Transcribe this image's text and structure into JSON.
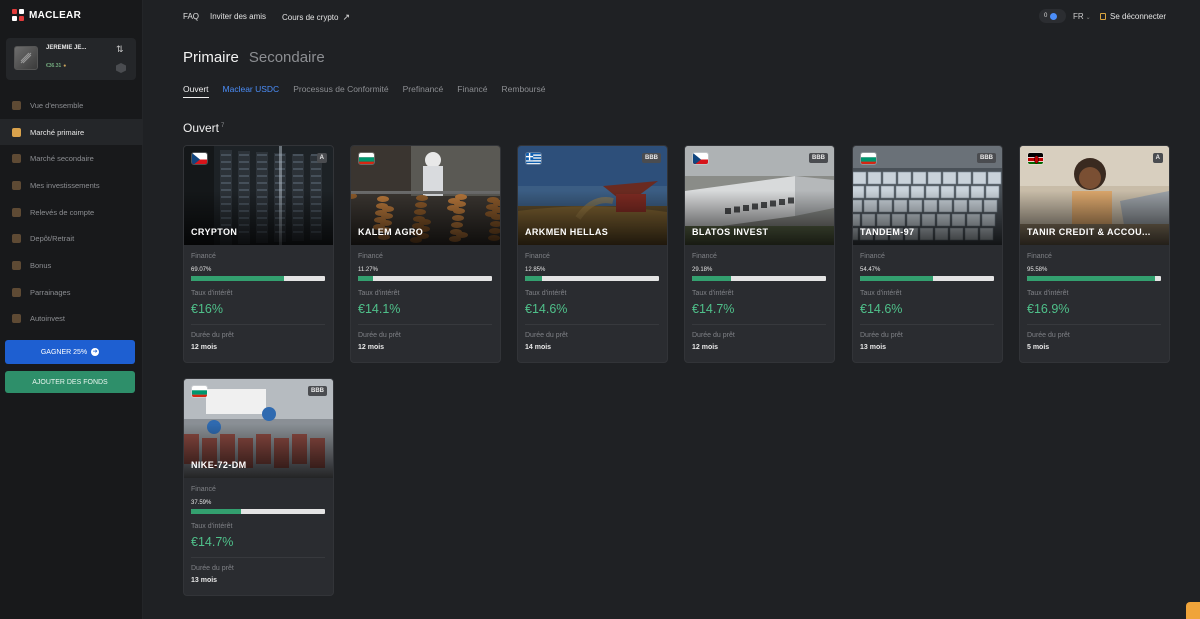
{
  "brand": {
    "name": "MACLEAR"
  },
  "user": {
    "name": "JEREMIE JE...",
    "balance": "€36.31"
  },
  "sidebar": {
    "items": [
      {
        "label": "Vue d'ensemble",
        "icon": "home-icon",
        "active": false
      },
      {
        "label": "Marché primaire",
        "icon": "mail-icon",
        "active": true
      },
      {
        "label": "Marché secondaire",
        "icon": "cart-icon",
        "active": false
      },
      {
        "label": "Mes investissements",
        "icon": "briefcase-icon",
        "active": false
      },
      {
        "label": "Relevés de compte",
        "icon": "folder-icon",
        "active": false
      },
      {
        "label": "Depôt/Retrait",
        "icon": "wallet-icon",
        "active": false
      },
      {
        "label": "Bonus",
        "icon": "coin-icon",
        "active": false
      },
      {
        "label": "Parrainages",
        "icon": "users-icon",
        "active": false
      },
      {
        "label": "Autoinvest",
        "icon": "autoinvest-icon",
        "active": false
      }
    ],
    "gain_button": "GAGNER 25%",
    "funds_button": "AJOUTER DES FONDS"
  },
  "topbar": {
    "faq": "FAQ",
    "invite": "Inviter des amis",
    "crypto": "Cours de crypto",
    "counter": "0",
    "lang": "FR",
    "logout": "Se déconnecter"
  },
  "main": {
    "tabs": [
      "Primaire",
      "Secondaire"
    ],
    "filters": [
      "Ouvert",
      "Maclear USDC",
      "Processus de Conformité",
      "Prefinancé",
      "Financé",
      "Remboursé"
    ],
    "section_title": "Ouvert",
    "section_count": "7",
    "labels": {
      "funded": "Financé",
      "rate": "Taux d'intérêt",
      "duration": "Durée du prêt"
    }
  },
  "colors": {
    "accent_green": "#33a06f",
    "rate_green": "#4fc08a",
    "blue": "#1e5fd1",
    "funds_green": "#2e8f6a"
  },
  "cards": [
    {
      "name": "CRYPTON",
      "flag": "CZ",
      "rating": "A",
      "funded": "69.07%",
      "funded_value": 69.07,
      "rate": "€16%",
      "duration": "12 mois",
      "scene": "server"
    },
    {
      "name": "KALEM AGRO",
      "flag": "BG",
      "rating": "",
      "funded": "11.27%",
      "funded_value": 11.27,
      "rate": "€14.1%",
      "duration": "12 mois",
      "scene": "food"
    },
    {
      "name": "ARKMEN HELLAS",
      "flag": "GR",
      "rating": "BBB",
      "funded": "12.85%",
      "funded_value": 12.85,
      "rate": "€14.6%",
      "duration": "14 mois",
      "scene": "field"
    },
    {
      "name": "BLATOS INVEST",
      "flag": "CZ",
      "rating": "BBB",
      "funded": "29.18%",
      "funded_value": 29.18,
      "rate": "€14.7%",
      "duration": "12 mois",
      "scene": "warehouse"
    },
    {
      "name": "TANDEM-97",
      "flag": "BG",
      "rating": "BBB",
      "funded": "54.47%",
      "funded_value": 54.47,
      "rate": "€14.6%",
      "duration": "13 mois",
      "scene": "tanks"
    },
    {
      "name": "TANIR CREDIT & ACCOU...",
      "flag": "KE",
      "rating": "A",
      "funded": "95.58%",
      "funded_value": 95.58,
      "rate": "€16.9%",
      "duration": "5 mois",
      "scene": "office"
    },
    {
      "name": "NIKE-72-DM",
      "flag": "BG",
      "rating": "BBB",
      "funded": "37.59%",
      "funded_value": 37.59,
      "rate": "€14.7%",
      "duration": "13 mois",
      "scene": "meat"
    }
  ]
}
